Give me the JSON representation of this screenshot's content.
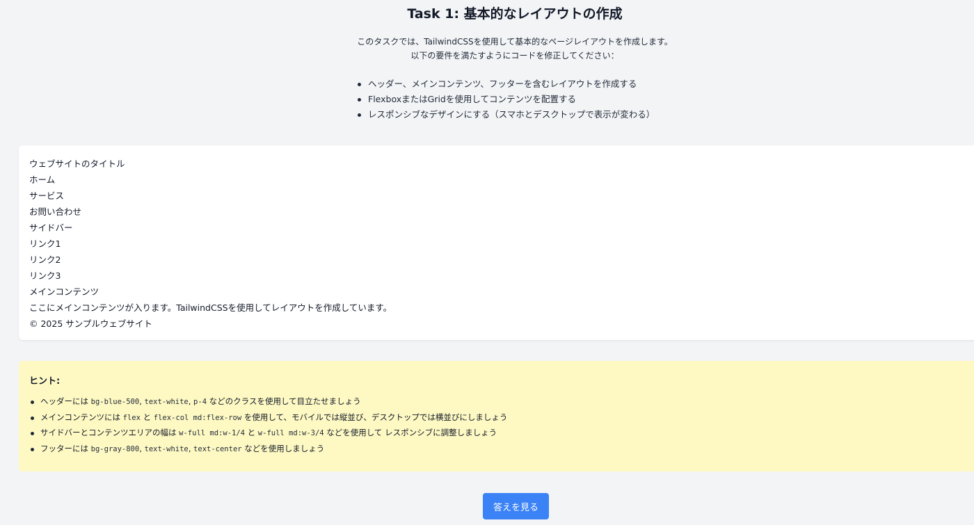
{
  "task": {
    "title": "Task 1: 基本的なレイアウトの作成",
    "intro_line1": "このタスクでは、TailwindCSSを使用して基本的なページレイアウトを作成します。",
    "intro_line2": "以下の要件を満たすようにコードを修正してください：",
    "requirements": [
      "ヘッダー、メインコンテンツ、フッターを含むレイアウトを作成する",
      "FlexboxまたはGridを使用してコンテンツを配置する",
      "レスポンシブなデザインにする（スマホとデスクトップで表示が変わる）"
    ]
  },
  "layout": {
    "site_title": "ウェブサイトのタイトル",
    "nav": [
      "ホーム",
      "サービス",
      "お問い合わせ"
    ],
    "sidebar_title": "サイドバー",
    "sidebar_links": [
      "リンク1",
      "リンク2",
      "リンク3"
    ],
    "main_title": "メインコンテンツ",
    "main_text": "ここにメインコンテンツが入ります。TailwindCSSを使用してレイアウトを作成しています。",
    "footer": "© 2025 サンプルウェブサイト"
  },
  "hints": {
    "title": "ヒント:",
    "h1": {
      "t1": "ヘッダーには ",
      "c1": "bg-blue-500",
      "s1": ", ",
      "c2": "text-white",
      "s2": ", ",
      "c3": "p-4",
      "t2": " などのクラスを使用して目立たせましょう"
    },
    "h2": {
      "t1": "メインコンテンツには ",
      "c1": "flex",
      "t2": " と ",
      "c2": "flex-col md:flex-row",
      "t3": " を使用して、モバイルでは縦並び、デスクトップでは横並びにしましょう"
    },
    "h3": {
      "t1": "サイドバーとコンテンツエリアの幅は ",
      "c1": "w-full md:w-1/4",
      "t2": " と ",
      "c2": "w-full md:w-3/4",
      "t3": " などを使用して レスポンシブに調整しましょう"
    },
    "h4": {
      "t1": "フッターには ",
      "c1": "bg-gray-800",
      "s1": ", ",
      "c2": "text-white",
      "s2": ", ",
      "c3": "text-center",
      "t2": " などを使用しましょう"
    }
  },
  "answer_button_label": "答えを見る",
  "colors": {
    "page_bg": "#f3f4f6",
    "hint_bg": "#fef9c3",
    "button_bg": "#3b82f6"
  }
}
